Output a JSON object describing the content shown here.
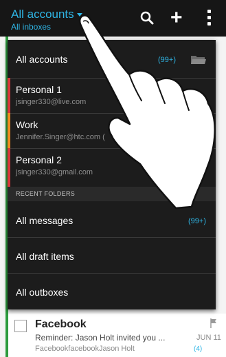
{
  "topbar": {
    "title": "All accounts",
    "subtitle": "All inboxes",
    "icons": [
      "search-icon",
      "plus-icon",
      "more-options-icon"
    ]
  },
  "dropdown": {
    "accounts": [
      {
        "label": "All accounts",
        "count": "(99+)",
        "icon": "folder-icon"
      },
      {
        "label": "Personal 1",
        "email": "jsinger330@live.com",
        "color": "#d9363a"
      },
      {
        "label": "Work",
        "email": "Jennifer.Singer@htc.com (",
        "color": "#f28a1e"
      },
      {
        "label": "Personal 2",
        "email": "jsinger330@gmail.com",
        "color": "#d9363a"
      }
    ],
    "recent_header": "RECENT FOLDERS",
    "folders": [
      {
        "label": "All messages",
        "count": "(99+)"
      },
      {
        "label": "All draft items"
      },
      {
        "label": "All outboxes"
      }
    ]
  },
  "background_mail": {
    "sender": "Facebook",
    "subject": "Reminder: Jason Holt invited you ...",
    "preview": "FacebookfacebookJason Holt",
    "date": "JUN 11",
    "count": "(4)"
  },
  "colors": {
    "accent": "#2fb6e6",
    "work": "#f28a1e",
    "personal": "#d9363a",
    "stripe_green": "#2c9b3d"
  }
}
